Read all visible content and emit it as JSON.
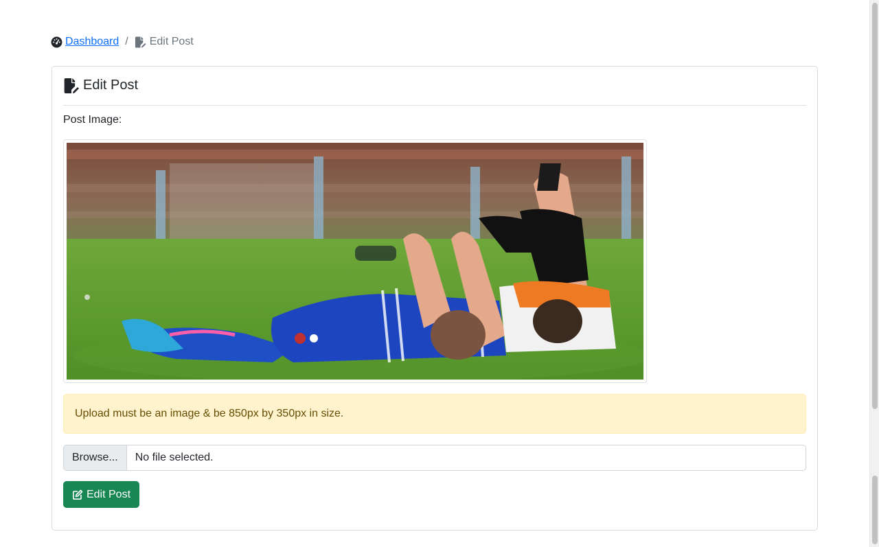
{
  "breadcrumb": {
    "home_icon": "tachometer-icon",
    "home_label": "Dashboard",
    "separator": "/",
    "current_icon": "file-edit-icon",
    "current_label": "Edit Post"
  },
  "card": {
    "title_icon": "file-edit-icon",
    "title": "Edit Post",
    "post_image_label": "Post Image:",
    "alert_text": "Upload must be an image & be 850px by 350px in size.",
    "file_input": {
      "browse_label": "Browse...",
      "filename": "No file selected."
    },
    "submit": {
      "icon": "edit-icon",
      "label": "Edit Post"
    }
  },
  "colors": {
    "link": "#0d6efd",
    "alert_bg": "#fff3cd",
    "alert_text": "#664d03",
    "submit_bg": "#198754"
  }
}
